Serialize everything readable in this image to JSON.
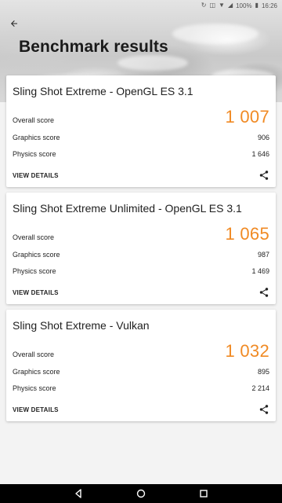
{
  "status_bar": {
    "battery": "100%",
    "time": "16:26"
  },
  "header": {
    "title": "Benchmark results"
  },
  "cards": [
    {
      "title": "Sling Shot Extreme - OpenGL ES 3.1",
      "overall_label": "Overall score",
      "overall_value": "1 007",
      "graphics_label": "Graphics score",
      "graphics_value": "906",
      "physics_label": "Physics score",
      "physics_value": "1 646",
      "view_details": "VIEW DETAILS"
    },
    {
      "title": "Sling Shot Extreme Unlimited - OpenGL ES 3.1",
      "overall_label": "Overall score",
      "overall_value": "1 065",
      "graphics_label": "Graphics score",
      "graphics_value": "987",
      "physics_label": "Physics score",
      "physics_value": "1 469",
      "view_details": "VIEW DETAILS"
    },
    {
      "title": "Sling Shot Extreme - Vulkan",
      "overall_label": "Overall score",
      "overall_value": "1 032",
      "graphics_label": "Graphics score",
      "graphics_value": "895",
      "physics_label": "Physics score",
      "physics_value": "2 214",
      "view_details": "VIEW DETAILS"
    }
  ],
  "icons": {
    "back": "arrow-left-icon",
    "share": "share-icon",
    "nav_back": "triangle-back-icon",
    "nav_home": "circle-home-icon",
    "nav_recents": "square-recents-icon"
  },
  "colors": {
    "accent": "#f08a24",
    "background": "#f3f3f3",
    "card": "#ffffff",
    "nav_bar": "#000000"
  }
}
